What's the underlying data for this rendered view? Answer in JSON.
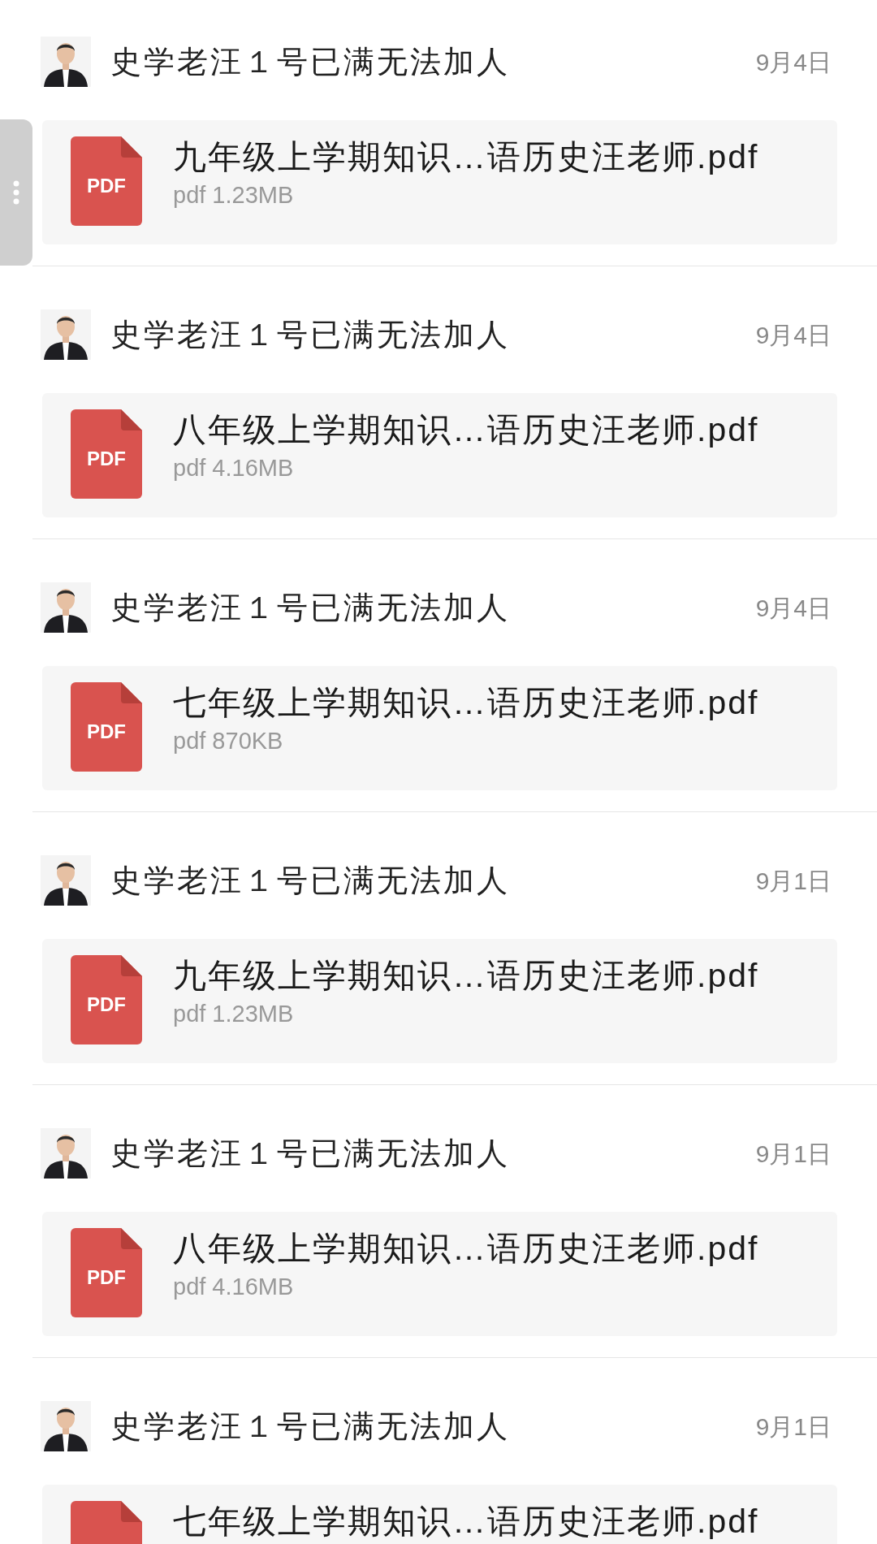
{
  "side_handle": {
    "kind": "handle"
  },
  "messages": [
    {
      "sender": "史学老汪１号已满无法加人",
      "date": "9月4日",
      "file": {
        "icon_label": "PDF",
        "name": "九年级上学期知识…语历史汪老师.pdf",
        "meta": "pdf 1.23MB"
      }
    },
    {
      "sender": "史学老汪１号已满无法加人",
      "date": "9月4日",
      "file": {
        "icon_label": "PDF",
        "name": "八年级上学期知识…语历史汪老师.pdf",
        "meta": "pdf 4.16MB"
      }
    },
    {
      "sender": "史学老汪１号已满无法加人",
      "date": "9月4日",
      "file": {
        "icon_label": "PDF",
        "name": "七年级上学期知识…语历史汪老师.pdf",
        "meta": "pdf 870KB"
      }
    },
    {
      "sender": "史学老汪１号已满无法加人",
      "date": "9月1日",
      "file": {
        "icon_label": "PDF",
        "name": "九年级上学期知识…语历史汪老师.pdf",
        "meta": "pdf 1.23MB"
      }
    },
    {
      "sender": "史学老汪１号已满无法加人",
      "date": "9月1日",
      "file": {
        "icon_label": "PDF",
        "name": "八年级上学期知识…语历史汪老师.pdf",
        "meta": "pdf 4.16MB"
      }
    },
    {
      "sender": "史学老汪１号已满无法加人",
      "date": "9月1日",
      "file": {
        "name": "七年级上学期知识…语历史汪老师.pdf"
      }
    }
  ]
}
